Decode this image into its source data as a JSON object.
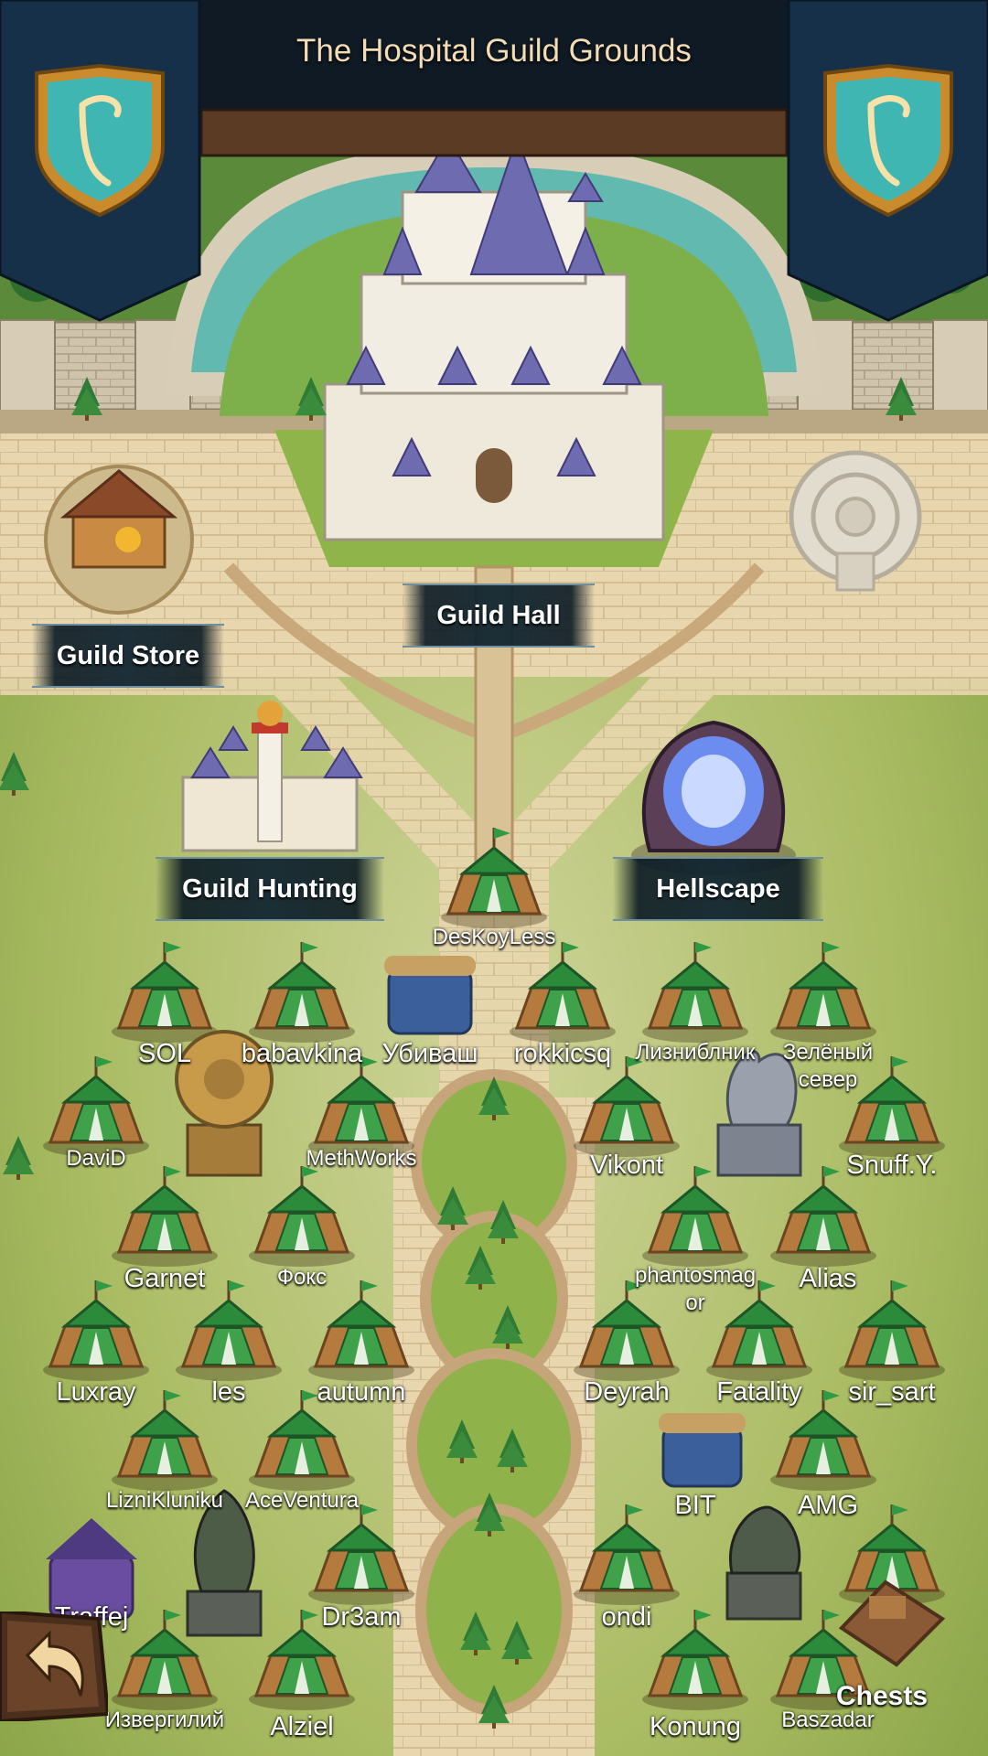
{
  "header": {
    "title": "The Hospital Guild Grounds"
  },
  "emblem": {
    "icon": "harp-emblem-icon",
    "color_teal": "#3fb6b1",
    "color_gold": "#c98b2b"
  },
  "buildings": {
    "guild_hall": "Guild Hall",
    "guild_store": "Guild Store",
    "guild_hunting": "Guild Hunting",
    "hellscape": "Hellscape",
    "chests": "Chests"
  },
  "players": {
    "deskoyless": "DesKoyLess",
    "sol": "SOL",
    "babavkina": "babavkina",
    "ubivash": "Убиваш",
    "rokkicsq": "rokkicsq",
    "liznibnik": "Лизниблник",
    "zeleny_sever": "Зелёный север",
    "david": "DaviD",
    "methworks": "MethWorks",
    "vikont": "Vikont",
    "snuffy": "Snuff.Y.",
    "garnet": "Garnet",
    "foks": "Фокс",
    "phantosmagor": "phantosmagor",
    "alias": "Alias",
    "luxray": "Luxray",
    "les": "les",
    "autumn": "autumn",
    "deyrah": "Deyrah",
    "fatality": "Fatality",
    "sir_sart": "sir_sart",
    "liznikluniku": "LizniKluniku",
    "aceventura": "AceVentura",
    "bit": "BIT",
    "amg": "AMG",
    "traffej": "Traffej",
    "dr3am": "Dr3am",
    "ondi": "ondi",
    "izvergiliy": "Извергилий",
    "alziel": "Alziel",
    "konung": "Konung",
    "baszadar": "Baszadar"
  },
  "controls": {
    "back_icon": "back-arrow-icon"
  }
}
